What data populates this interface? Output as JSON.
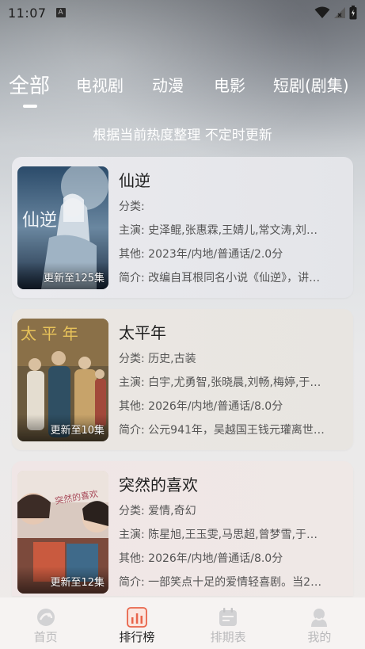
{
  "status_bar": {
    "time": "11:07",
    "notification_badge": "A",
    "icons": [
      "wifi-icon",
      "signal-icon",
      "battery-icon"
    ]
  },
  "tabs": [
    {
      "label": "全部",
      "active": true
    },
    {
      "label": "电视剧",
      "active": false
    },
    {
      "label": "动漫",
      "active": false
    },
    {
      "label": "电影",
      "active": false
    },
    {
      "label": "短剧(剧集)",
      "active": false
    }
  ],
  "subtitle": "根据当前热度整理 不定时更新",
  "items": [
    {
      "title": "仙逆",
      "badge": "更新至125集",
      "category": "分类:",
      "cast": "主演:  史泽鲲,张惠霖,王婧儿,常文涛,刘…",
      "other": "其他:  2023年/内地/普通话/2.0分",
      "intro": "简介:  改编自耳根同名小说《仙逆》，讲…",
      "poster_text": "仙逆"
    },
    {
      "title": "太平年",
      "badge": "更新至10集",
      "category": "分类:  历史,古装",
      "cast": "主演:  白宇,尤勇智,张晓晨,刘畅,梅婷,于…",
      "other": "其他:  2026年/内地/普通话/8.0分",
      "intro": "简介:  公元941年，吴越国王钱元瓘离世…",
      "poster_text": "太 平 年"
    },
    {
      "title": "突然的喜欢",
      "badge": "更新至12集",
      "category": "分类:  爱情,奇幻",
      "cast": "主演:  陈星旭,王玉雯,马思超,曾梦雪,于…",
      "other": "其他:  2026年/内地/普通话/8.0分",
      "intro": "简介:  一部笑点十足的爱情轻喜剧。当2…",
      "poster_text": "突然的喜欢"
    }
  ],
  "bottom_nav": [
    {
      "label": "首页",
      "icon": "home-icon",
      "active": false
    },
    {
      "label": "排行榜",
      "icon": "ranking-icon",
      "active": true
    },
    {
      "label": "排期表",
      "icon": "schedule-icon",
      "active": false
    },
    {
      "label": "我的",
      "icon": "profile-icon",
      "active": false
    }
  ],
  "colors": {
    "active_nav": "#222222",
    "inactive_nav": "#b9b9bb",
    "ranking_accent": "#e8644a"
  }
}
